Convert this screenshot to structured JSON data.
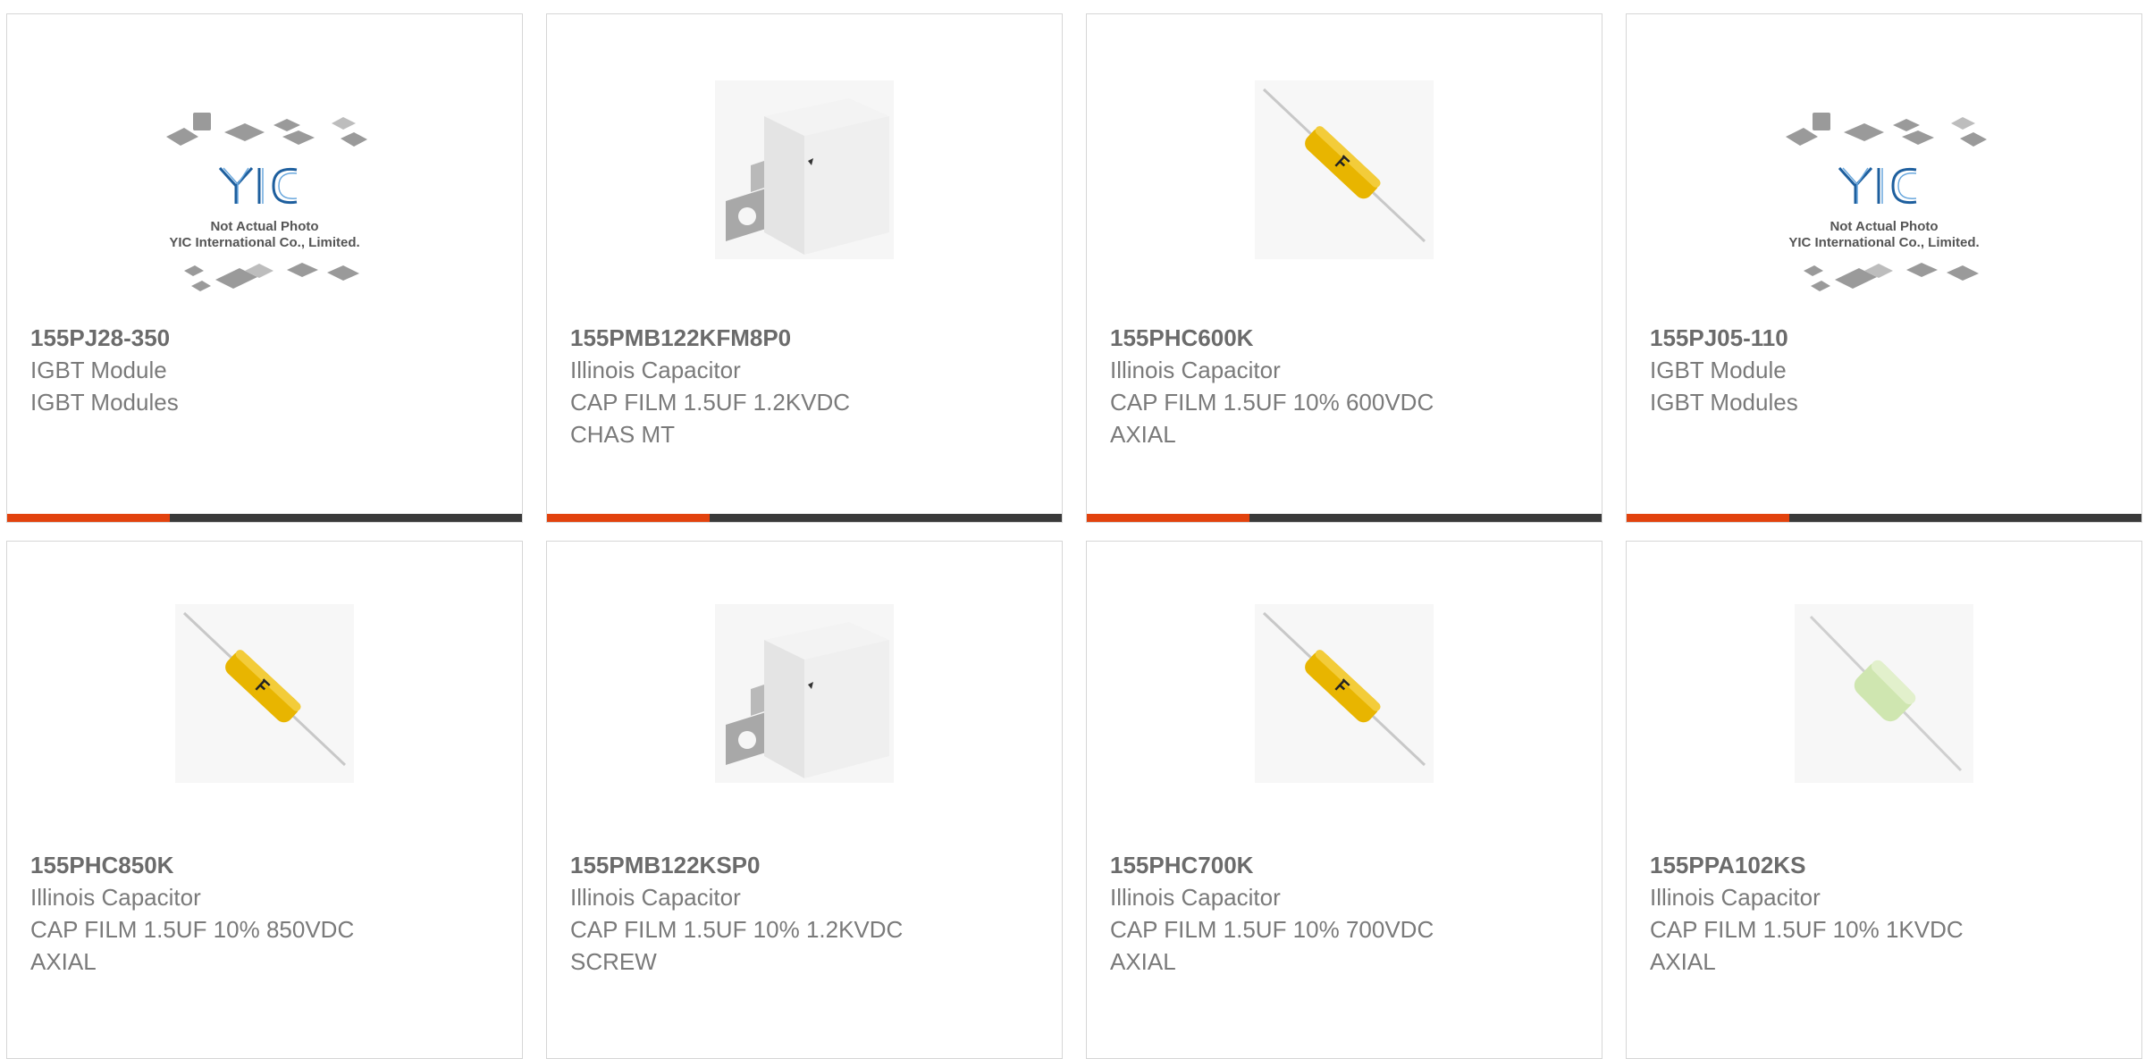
{
  "colors": {
    "accent": "#e2420d",
    "bar_dark": "#3a3a3a",
    "border": "#d6d6d6",
    "text": "#7a7a7a"
  },
  "placeholder": {
    "line1": "Not Actual Photo",
    "line2": "YIC International Co., Limited.",
    "logo": "YIC"
  },
  "products": [
    {
      "part_number": "155PJ28-350",
      "manufacturer": "IGBT Module",
      "desc1": "IGBT Modules",
      "desc2": "",
      "image": "placeholder-icon"
    },
    {
      "part_number": "155PMB122KFM8P0",
      "manufacturer": "Illinois Capacitor",
      "desc1": "CAP FILM 1.5UF 1.2KVDC",
      "desc2": "CHAS MT",
      "image": "box-capacitor-icon"
    },
    {
      "part_number": "155PHC600K",
      "manufacturer": "Illinois Capacitor",
      "desc1": "CAP FILM 1.5UF 10% 600VDC",
      "desc2": "AXIAL",
      "image": "axial-capacitor-icon"
    },
    {
      "part_number": "155PJ05-110",
      "manufacturer": "IGBT Module",
      "desc1": "IGBT Modules",
      "desc2": "",
      "image": "placeholder-icon"
    },
    {
      "part_number": "155PHC850K",
      "manufacturer": "Illinois Capacitor",
      "desc1": "CAP FILM 1.5UF 10% 850VDC",
      "desc2": "AXIAL",
      "image": "axial-capacitor-icon"
    },
    {
      "part_number": "155PMB122KSP0",
      "manufacturer": "Illinois Capacitor",
      "desc1": "CAP FILM 1.5UF 10% 1.2KVDC",
      "desc2": "SCREW",
      "image": "box-capacitor-icon"
    },
    {
      "part_number": "155PHC700K",
      "manufacturer": "Illinois Capacitor",
      "desc1": "CAP FILM 1.5UF 10% 700VDC",
      "desc2": "AXIAL",
      "image": "axial-capacitor-icon"
    },
    {
      "part_number": "155PPA102KS",
      "manufacturer": "Illinois Capacitor",
      "desc1": "CAP FILM 1.5UF 10% 1KVDC",
      "desc2": "AXIAL",
      "image": "axial-green-capacitor-icon"
    }
  ]
}
